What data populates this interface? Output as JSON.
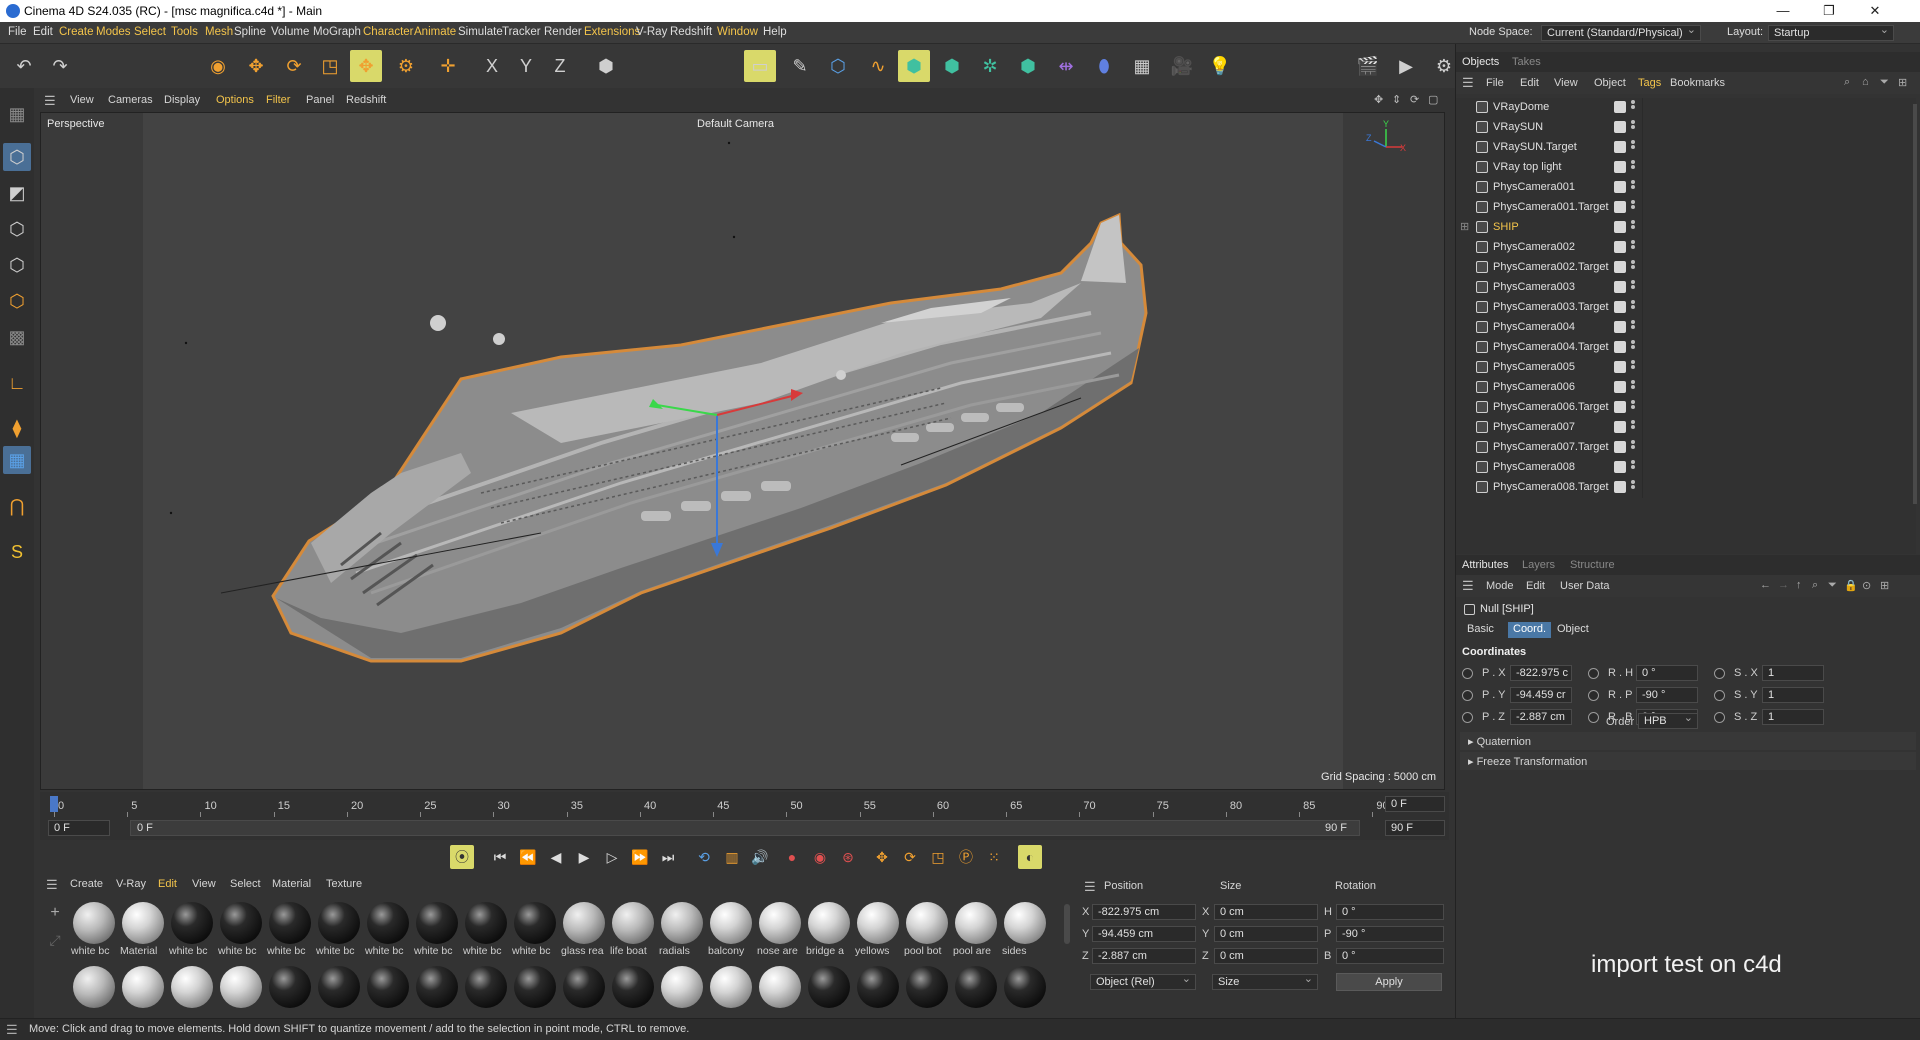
{
  "window": {
    "title": "Cinema 4D S24.035 (RC) - [msc magnifica.c4d *] - Main",
    "controls": [
      "—",
      "❐",
      "✕"
    ]
  },
  "menubar": {
    "items": [
      {
        "label": "File",
        "accent": false
      },
      {
        "label": "Edit",
        "accent": false
      },
      {
        "label": "Create",
        "accent": true
      },
      {
        "label": "Modes",
        "accent": true
      },
      {
        "label": "Select",
        "accent": true
      },
      {
        "label": "Tools",
        "accent": true
      },
      {
        "label": "Mesh",
        "accent": true
      },
      {
        "label": "Spline",
        "accent": false
      },
      {
        "label": "Volume",
        "accent": false
      },
      {
        "label": "MoGraph",
        "accent": false
      },
      {
        "label": "Character",
        "accent": true
      },
      {
        "label": "Animate",
        "accent": true
      },
      {
        "label": "Simulate",
        "accent": false
      },
      {
        "label": "Tracker",
        "accent": false
      },
      {
        "label": "Render",
        "accent": false
      },
      {
        "label": "Extensions",
        "accent": true
      },
      {
        "label": "V-Ray",
        "accent": false
      },
      {
        "label": "Redshift",
        "accent": false
      },
      {
        "label": "Window",
        "accent": true
      },
      {
        "label": "Help",
        "accent": false
      }
    ],
    "node_space_label": "Node Space:",
    "node_space_value": "Current (Standard/Physical)",
    "layout_label": "Layout:",
    "layout_value": "Startup"
  },
  "toolbar": {
    "buttons": [
      {
        "name": "undo-icon",
        "glyph": "↶"
      },
      {
        "name": "redo-icon",
        "glyph": "↷"
      },
      {
        "name": "live-selection-icon",
        "glyph": "◉"
      },
      {
        "name": "move-icon",
        "glyph": "✥"
      },
      {
        "name": "rotate-icon",
        "glyph": "⟳"
      },
      {
        "name": "scale-icon",
        "glyph": "◳"
      },
      {
        "name": "select-transform-icon",
        "glyph": "✥"
      },
      {
        "name": "place-icon",
        "glyph": "⚙"
      },
      {
        "name": "world-axis-icon",
        "glyph": "✛"
      },
      {
        "name": "x-axis-lock-icon",
        "glyph": "X"
      },
      {
        "name": "y-axis-lock-icon",
        "glyph": "Y"
      },
      {
        "name": "z-axis-lock-icon",
        "glyph": "Z"
      },
      {
        "name": "coordinate-system-icon",
        "glyph": "⬢"
      },
      {
        "name": "make-editable-icon",
        "glyph": "▭"
      },
      {
        "name": "spline-pen-icon",
        "glyph": "✎"
      },
      {
        "name": "cube-icon",
        "glyph": "⬡"
      },
      {
        "name": "sweep-icon",
        "glyph": "∿"
      },
      {
        "name": "subdivision-icon",
        "glyph": "⬢"
      },
      {
        "name": "extrude-icon",
        "glyph": "⬢"
      },
      {
        "name": "cloner-icon",
        "glyph": "✲"
      },
      {
        "name": "fracture-icon",
        "glyph": "⬢"
      },
      {
        "name": "symmetry-icon",
        "glyph": "⇹"
      },
      {
        "name": "bend-icon",
        "glyph": "⬮"
      },
      {
        "name": "floor-icon",
        "glyph": "▦"
      },
      {
        "name": "camera-icon",
        "glyph": "🎥"
      },
      {
        "name": "light-icon",
        "glyph": "💡"
      },
      {
        "name": "render-region-icon",
        "glyph": "🎬"
      },
      {
        "name": "render-viewport-icon",
        "glyph": "▶"
      },
      {
        "name": "render-settings-icon",
        "glyph": "⚙"
      }
    ]
  },
  "viewport": {
    "menu": [
      {
        "label": "View",
        "accent": false
      },
      {
        "label": "Cameras",
        "accent": false
      },
      {
        "label": "Display",
        "accent": false
      },
      {
        "label": "Options",
        "accent": true
      },
      {
        "label": "Filter",
        "accent": true
      },
      {
        "label": "Panel",
        "accent": false
      },
      {
        "label": "Redshift",
        "accent": false
      }
    ],
    "label": "Perspective",
    "camera": "Default Camera",
    "grid_spacing": "Grid Spacing : 5000 cm",
    "axis_labels": {
      "y": "Y",
      "z": "Z",
      "x": "X"
    }
  },
  "timeline": {
    "ticks": [
      "0",
      "5",
      "10",
      "15",
      "20",
      "25",
      "30",
      "35",
      "40",
      "45",
      "50",
      "55",
      "60",
      "65",
      "70",
      "75",
      "80",
      "85",
      "90"
    ],
    "current_frame": "0 F",
    "start": "0 F",
    "range_start": "0 F",
    "range_end": "90 F",
    "end": "90 F",
    "max": "90 F"
  },
  "material_manager": {
    "menu": [
      {
        "label": "Create",
        "accent": false
      },
      {
        "label": "V-Ray",
        "accent": false
      },
      {
        "label": "Edit",
        "accent": true
      },
      {
        "label": "View",
        "accent": false
      },
      {
        "label": "Select",
        "accent": false
      },
      {
        "label": "Material",
        "accent": false
      },
      {
        "label": "Texture",
        "accent": false
      }
    ],
    "row1": [
      {
        "label": "white bc",
        "kind": "grey"
      },
      {
        "label": "Material",
        "kind": "white"
      },
      {
        "label": "white bc",
        "kind": "black"
      },
      {
        "label": "white bc",
        "kind": "black"
      },
      {
        "label": "white bc",
        "kind": "black"
      },
      {
        "label": "white bc",
        "kind": "black"
      },
      {
        "label": "white bc",
        "kind": "black"
      },
      {
        "label": "white bc",
        "kind": "black"
      },
      {
        "label": "white bc",
        "kind": "black"
      },
      {
        "label": "white bc",
        "kind": "black"
      },
      {
        "label": "glass rea",
        "kind": "grey"
      },
      {
        "label": "life boat",
        "kind": "grey"
      },
      {
        "label": "radials",
        "kind": "grey"
      },
      {
        "label": "balcony",
        "kind": "white"
      },
      {
        "label": "nose are",
        "kind": "white"
      },
      {
        "label": "bridge a",
        "kind": "white"
      },
      {
        "label": "yellows",
        "kind": "white"
      },
      {
        "label": "pool bot",
        "kind": "white"
      },
      {
        "label": "pool are",
        "kind": "white"
      },
      {
        "label": "sides",
        "kind": "white"
      }
    ],
    "row2": [
      "grey",
      "white",
      "white",
      "white",
      "black",
      "black",
      "black",
      "black",
      "black",
      "black",
      "black",
      "black",
      "white",
      "white",
      "white",
      "black",
      "black",
      "black",
      "black",
      "black"
    ]
  },
  "coordinates": {
    "headers": {
      "position": "Position",
      "size": "Size",
      "rotation": "Rotation"
    },
    "rows": [
      {
        "axis": "X",
        "pos": "-822.975 cm",
        "size_axis": "X",
        "size": "0 cm",
        "rot_axis": "H",
        "rot": "0 °"
      },
      {
        "axis": "Y",
        "pos": "-94.459 cm",
        "size_axis": "Y",
        "size": "0 cm",
        "rot_axis": "P",
        "rot": "-90 °"
      },
      {
        "axis": "Z",
        "pos": "-2.887 cm",
        "size_axis": "Z",
        "size": "0 cm",
        "rot_axis": "B",
        "rot": "0 °"
      }
    ],
    "mode": "Object (Rel)",
    "size_mode": "Size",
    "apply": "Apply"
  },
  "status": "Move: Click and drag to move elements. Hold down SHIFT to quantize movement / add to the selection in point mode, CTRL to remove.",
  "objects_panel": {
    "tabs": [
      "Objects",
      "Takes"
    ],
    "menu": [
      {
        "label": "File",
        "accent": false
      },
      {
        "label": "Edit",
        "accent": false
      },
      {
        "label": "View",
        "accent": false
      },
      {
        "label": "Object",
        "accent": false
      },
      {
        "label": "Tags",
        "accent": true
      },
      {
        "label": "Bookmarks",
        "accent": false
      }
    ],
    "items": [
      {
        "name": "VRayDome",
        "selected": false
      },
      {
        "name": "VRaySUN",
        "selected": false
      },
      {
        "name": "VRaySUN.Target",
        "selected": false
      },
      {
        "name": "VRay top light",
        "selected": false
      },
      {
        "name": "PhysCamera001",
        "selected": false
      },
      {
        "name": "PhysCamera001.Target",
        "selected": false
      },
      {
        "name": "SHIP",
        "selected": true
      },
      {
        "name": "PhysCamera002",
        "selected": false
      },
      {
        "name": "PhysCamera002.Target",
        "selected": false
      },
      {
        "name": "PhysCamera003",
        "selected": false
      },
      {
        "name": "PhysCamera003.Target",
        "selected": false
      },
      {
        "name": "PhysCamera004",
        "selected": false
      },
      {
        "name": "PhysCamera004.Target",
        "selected": false
      },
      {
        "name": "PhysCamera005",
        "selected": false
      },
      {
        "name": "PhysCamera006",
        "selected": false
      },
      {
        "name": "PhysCamera006.Target",
        "selected": false
      },
      {
        "name": "PhysCamera007",
        "selected": false
      },
      {
        "name": "PhysCamera007.Target",
        "selected": false
      },
      {
        "name": "PhysCamera008",
        "selected": false
      },
      {
        "name": "PhysCamera008.Target",
        "selected": false
      }
    ]
  },
  "attributes_panel": {
    "tabs": [
      "Attributes",
      "Layers",
      "Structure"
    ],
    "menu": [
      "Mode",
      "Edit",
      "User Data"
    ],
    "object_title": "Null [SHIP]",
    "subtabs": [
      {
        "label": "Basic",
        "on": false
      },
      {
        "label": "Coord.",
        "on": true
      },
      {
        "label": "Object",
        "on": false
      }
    ],
    "section": "Coordinates",
    "rows": [
      {
        "p_label": "P . X",
        "p_val": "-822.975 c",
        "r_label": "R . H",
        "r_val": "0 °",
        "s_label": "S . X",
        "s_val": "1"
      },
      {
        "p_label": "P . Y",
        "p_val": "-94.459 cr",
        "r_label": "R . P",
        "r_val": "-90 °",
        "s_label": "S . Y",
        "s_val": "1"
      },
      {
        "p_label": "P . Z",
        "p_val": "-2.887 cm",
        "r_label": "R . B",
        "r_val": "0 °",
        "s_label": "S . Z",
        "s_val": "1"
      }
    ],
    "order_label": "Order",
    "order_value": "HPB",
    "folds": [
      "Quaternion",
      "Freeze Transformation"
    ]
  },
  "overlay_text": "import test on c4d"
}
